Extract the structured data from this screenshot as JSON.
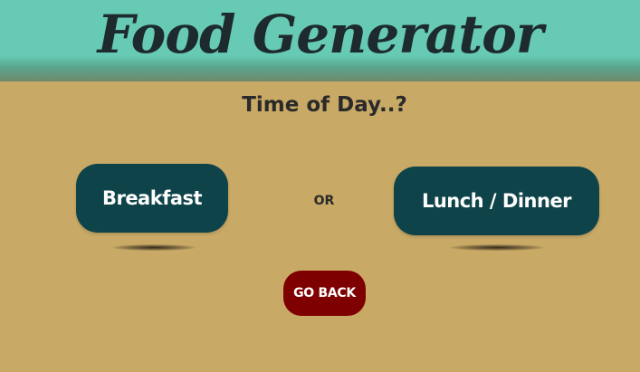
{
  "header": {
    "title": "Food Generator",
    "background_color": "#67cab4"
  },
  "main": {
    "question": "Time of Day..?",
    "or_label": "OR",
    "options": {
      "breakfast_label": "Breakfast",
      "lunch_dinner_label": "Lunch / Dinner"
    },
    "go_back_label": "GO BACK",
    "button_color": "#0f434a",
    "go_back_color": "#7f0000",
    "background_color": "#c9a966"
  }
}
